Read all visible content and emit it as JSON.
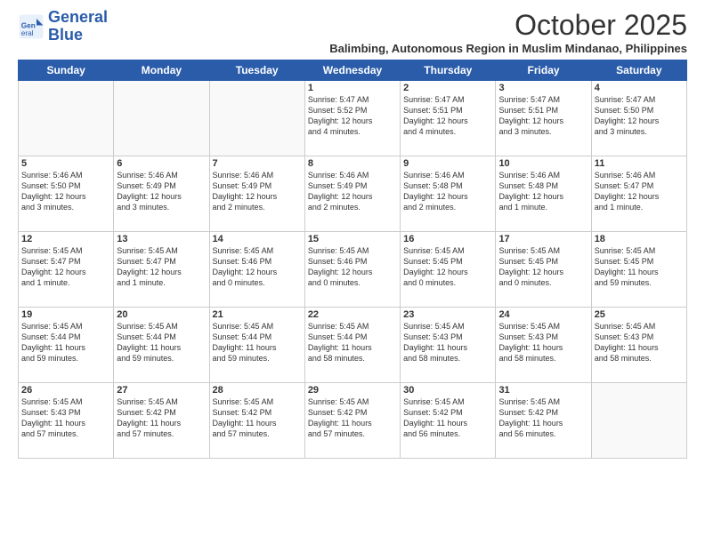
{
  "logo": {
    "line1": "General",
    "line2": "Blue"
  },
  "title": "October 2025",
  "subtitle": "Balimbing, Autonomous Region in Muslim Mindanao, Philippines",
  "weekdays": [
    "Sunday",
    "Monday",
    "Tuesday",
    "Wednesday",
    "Thursday",
    "Friday",
    "Saturday"
  ],
  "weeks": [
    [
      {
        "day": "",
        "info": ""
      },
      {
        "day": "",
        "info": ""
      },
      {
        "day": "",
        "info": ""
      },
      {
        "day": "1",
        "info": "Sunrise: 5:47 AM\nSunset: 5:52 PM\nDaylight: 12 hours\nand 4 minutes."
      },
      {
        "day": "2",
        "info": "Sunrise: 5:47 AM\nSunset: 5:51 PM\nDaylight: 12 hours\nand 4 minutes."
      },
      {
        "day": "3",
        "info": "Sunrise: 5:47 AM\nSunset: 5:51 PM\nDaylight: 12 hours\nand 3 minutes."
      },
      {
        "day": "4",
        "info": "Sunrise: 5:47 AM\nSunset: 5:50 PM\nDaylight: 12 hours\nand 3 minutes."
      }
    ],
    [
      {
        "day": "5",
        "info": "Sunrise: 5:46 AM\nSunset: 5:50 PM\nDaylight: 12 hours\nand 3 minutes."
      },
      {
        "day": "6",
        "info": "Sunrise: 5:46 AM\nSunset: 5:49 PM\nDaylight: 12 hours\nand 3 minutes."
      },
      {
        "day": "7",
        "info": "Sunrise: 5:46 AM\nSunset: 5:49 PM\nDaylight: 12 hours\nand 2 minutes."
      },
      {
        "day": "8",
        "info": "Sunrise: 5:46 AM\nSunset: 5:49 PM\nDaylight: 12 hours\nand 2 minutes."
      },
      {
        "day": "9",
        "info": "Sunrise: 5:46 AM\nSunset: 5:48 PM\nDaylight: 12 hours\nand 2 minutes."
      },
      {
        "day": "10",
        "info": "Sunrise: 5:46 AM\nSunset: 5:48 PM\nDaylight: 12 hours\nand 1 minute."
      },
      {
        "day": "11",
        "info": "Sunrise: 5:46 AM\nSunset: 5:47 PM\nDaylight: 12 hours\nand 1 minute."
      }
    ],
    [
      {
        "day": "12",
        "info": "Sunrise: 5:45 AM\nSunset: 5:47 PM\nDaylight: 12 hours\nand 1 minute."
      },
      {
        "day": "13",
        "info": "Sunrise: 5:45 AM\nSunset: 5:47 PM\nDaylight: 12 hours\nand 1 minute."
      },
      {
        "day": "14",
        "info": "Sunrise: 5:45 AM\nSunset: 5:46 PM\nDaylight: 12 hours\nand 0 minutes."
      },
      {
        "day": "15",
        "info": "Sunrise: 5:45 AM\nSunset: 5:46 PM\nDaylight: 12 hours\nand 0 minutes."
      },
      {
        "day": "16",
        "info": "Sunrise: 5:45 AM\nSunset: 5:45 PM\nDaylight: 12 hours\nand 0 minutes."
      },
      {
        "day": "17",
        "info": "Sunrise: 5:45 AM\nSunset: 5:45 PM\nDaylight: 12 hours\nand 0 minutes."
      },
      {
        "day": "18",
        "info": "Sunrise: 5:45 AM\nSunset: 5:45 PM\nDaylight: 11 hours\nand 59 minutes."
      }
    ],
    [
      {
        "day": "19",
        "info": "Sunrise: 5:45 AM\nSunset: 5:44 PM\nDaylight: 11 hours\nand 59 minutes."
      },
      {
        "day": "20",
        "info": "Sunrise: 5:45 AM\nSunset: 5:44 PM\nDaylight: 11 hours\nand 59 minutes."
      },
      {
        "day": "21",
        "info": "Sunrise: 5:45 AM\nSunset: 5:44 PM\nDaylight: 11 hours\nand 59 minutes."
      },
      {
        "day": "22",
        "info": "Sunrise: 5:45 AM\nSunset: 5:44 PM\nDaylight: 11 hours\nand 58 minutes."
      },
      {
        "day": "23",
        "info": "Sunrise: 5:45 AM\nSunset: 5:43 PM\nDaylight: 11 hours\nand 58 minutes."
      },
      {
        "day": "24",
        "info": "Sunrise: 5:45 AM\nSunset: 5:43 PM\nDaylight: 11 hours\nand 58 minutes."
      },
      {
        "day": "25",
        "info": "Sunrise: 5:45 AM\nSunset: 5:43 PM\nDaylight: 11 hours\nand 58 minutes."
      }
    ],
    [
      {
        "day": "26",
        "info": "Sunrise: 5:45 AM\nSunset: 5:43 PM\nDaylight: 11 hours\nand 57 minutes."
      },
      {
        "day": "27",
        "info": "Sunrise: 5:45 AM\nSunset: 5:42 PM\nDaylight: 11 hours\nand 57 minutes."
      },
      {
        "day": "28",
        "info": "Sunrise: 5:45 AM\nSunset: 5:42 PM\nDaylight: 11 hours\nand 57 minutes."
      },
      {
        "day": "29",
        "info": "Sunrise: 5:45 AM\nSunset: 5:42 PM\nDaylight: 11 hours\nand 57 minutes."
      },
      {
        "day": "30",
        "info": "Sunrise: 5:45 AM\nSunset: 5:42 PM\nDaylight: 11 hours\nand 56 minutes."
      },
      {
        "day": "31",
        "info": "Sunrise: 5:45 AM\nSunset: 5:42 PM\nDaylight: 11 hours\nand 56 minutes."
      },
      {
        "day": "",
        "info": ""
      }
    ]
  ]
}
